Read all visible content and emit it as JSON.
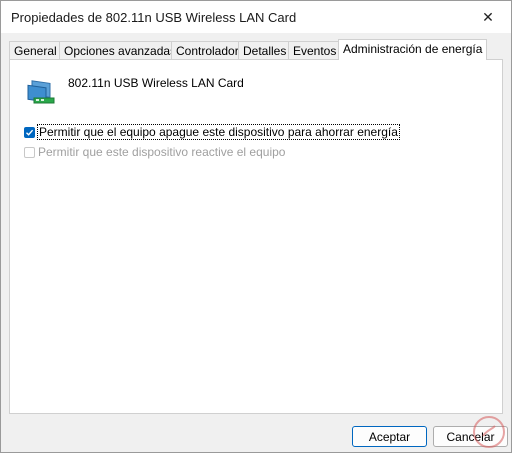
{
  "window": {
    "title": "Propiedades de 802.11n USB Wireless LAN Card",
    "close_glyph": "✕"
  },
  "tabs": [
    {
      "label": "General",
      "active": false
    },
    {
      "label": "Opciones avanzadas",
      "active": false
    },
    {
      "label": "Controlador",
      "active": false
    },
    {
      "label": "Detalles",
      "active": false
    },
    {
      "label": "Eventos",
      "active": false
    },
    {
      "label": "Administración de energía",
      "active": true
    }
  ],
  "panel": {
    "device_icon": "network-adapter-icon",
    "device_name": "802.11n USB Wireless LAN Card",
    "options": [
      {
        "label": "Permitir que el equipo apague este dispositivo para ahorrar energía",
        "checked": true,
        "enabled": true
      },
      {
        "label": "Permitir que este dispositivo reactive el equipo",
        "checked": false,
        "enabled": false
      }
    ]
  },
  "buttons": {
    "ok_label": "Aceptar",
    "cancel_label": "Cancelar"
  },
  "colors": {
    "accent": "#0067c0",
    "disabled_text": "#a0a0a0"
  }
}
